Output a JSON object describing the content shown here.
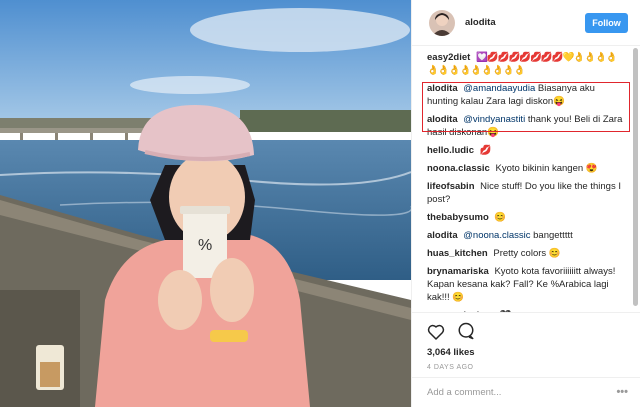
{
  "header": {
    "username": "alodita",
    "follow_label": "Follow"
  },
  "comments": [
    {
      "user": "easy2diet",
      "text": "💟💋💋💋💋💋💋💋💛👌👌👌👌👌👌👌👌👌👌👌👌👌"
    },
    {
      "user": "alodita",
      "mention": "@amandaayudia",
      "text": "Biasanya aku hunting kalau Zara lagi diskon😝",
      "highlighted": true
    },
    {
      "user": "alodita",
      "mention": "@vindyanastiti",
      "text": "thank you! Beli di Zara hasil diskonan😝",
      "highlighted": true
    },
    {
      "user": "hello.ludic",
      "text": "💋"
    },
    {
      "user": "noona.classic",
      "text": "Kyoto bikinin kangen 😍"
    },
    {
      "user": "lifeofsabin",
      "text": "Nice stuff! Do you like the things I post?"
    },
    {
      "user": "thebabysumo",
      "text": "😊"
    },
    {
      "user": "alodita",
      "mention": "@noona.classic",
      "text": "bangettttt"
    },
    {
      "user": "huas_kitchen",
      "text": "Pretty colors 😊"
    },
    {
      "user": "brynamariska",
      "text": "Kyoto kota favoriiiiiitt always! Kapan kesana kak? Fall? Ke %Arabica lagi kak!!! 😊"
    },
    {
      "user": "camaradeshop",
      "text": "🖤"
    }
  ],
  "actions": {
    "like_icon": "heart-icon",
    "comment_icon": "speech-bubble-icon",
    "likes": "3,064 likes",
    "date": "4 DAYS AGO"
  },
  "add_comment": {
    "placeholder": "Add a comment...",
    "more": "•••"
  },
  "colors": {
    "accent": "#3897f0",
    "highlight_border": "#e0262d"
  }
}
